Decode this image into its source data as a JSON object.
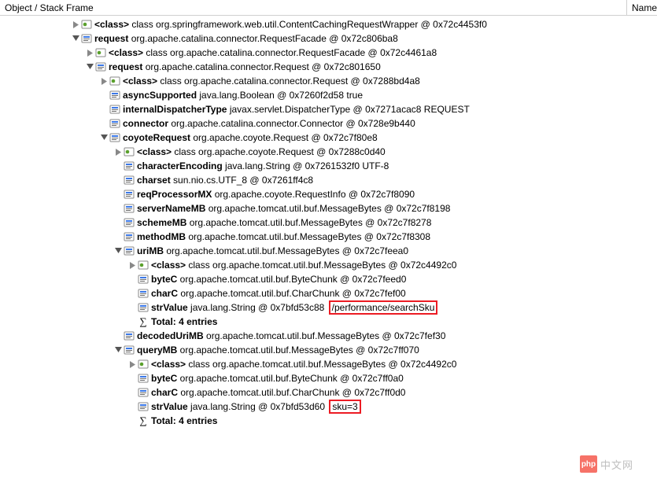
{
  "header": {
    "col1": "Object / Stack Frame",
    "col2": "Name"
  },
  "rows": [
    {
      "depth": 5,
      "tw": "r",
      "ic": "cls",
      "name": "<class>",
      "rest": " class org.springframework.web.util.ContentCachingRequestWrapper @ 0x72c4453f0"
    },
    {
      "depth": 5,
      "tw": "d",
      "ic": "obj",
      "name": "request",
      "rest": " org.apache.catalina.connector.RequestFacade @ 0x72c806ba8"
    },
    {
      "depth": 6,
      "tw": "r",
      "ic": "cls",
      "name": "<class>",
      "rest": " class org.apache.catalina.connector.RequestFacade @ 0x72c4461a8"
    },
    {
      "depth": 6,
      "tw": "d",
      "ic": "obj",
      "name": "request",
      "rest": " org.apache.catalina.connector.Request @ 0x72c801650"
    },
    {
      "depth": 7,
      "tw": "r",
      "ic": "cls",
      "name": "<class>",
      "rest": " class org.apache.catalina.connector.Request @ 0x7288bd4a8"
    },
    {
      "depth": 7,
      "tw": "n",
      "ic": "obj",
      "name": "asyncSupported",
      "rest": " java.lang.Boolean @ 0x7260f2d58  true"
    },
    {
      "depth": 7,
      "tw": "n",
      "ic": "obj",
      "name": "internalDispatcherType",
      "rest": " javax.servlet.DispatcherType @ 0x7271acac8  REQUEST"
    },
    {
      "depth": 7,
      "tw": "n",
      "ic": "obj",
      "name": "connector",
      "rest": " org.apache.catalina.connector.Connector @ 0x728e9b440"
    },
    {
      "depth": 7,
      "tw": "d",
      "ic": "obj",
      "name": "coyoteRequest",
      "rest": " org.apache.coyote.Request @ 0x72c7f80e8"
    },
    {
      "depth": 8,
      "tw": "r",
      "ic": "cls",
      "name": "<class>",
      "rest": " class org.apache.coyote.Request @ 0x7288c0d40"
    },
    {
      "depth": 8,
      "tw": "n",
      "ic": "obj",
      "name": "characterEncoding",
      "rest": " java.lang.String @ 0x7261532f0  UTF-8"
    },
    {
      "depth": 8,
      "tw": "n",
      "ic": "obj",
      "name": "charset",
      "rest": " sun.nio.cs.UTF_8 @ 0x7261ff4c8"
    },
    {
      "depth": 8,
      "tw": "n",
      "ic": "obj",
      "name": "reqProcessorMX",
      "rest": " org.apache.coyote.RequestInfo @ 0x72c7f8090"
    },
    {
      "depth": 8,
      "tw": "n",
      "ic": "obj",
      "name": "serverNameMB",
      "rest": " org.apache.tomcat.util.buf.MessageBytes @ 0x72c7f8198"
    },
    {
      "depth": 8,
      "tw": "n",
      "ic": "obj",
      "name": "schemeMB",
      "rest": " org.apache.tomcat.util.buf.MessageBytes @ 0x72c7f8278"
    },
    {
      "depth": 8,
      "tw": "n",
      "ic": "obj",
      "name": "methodMB",
      "rest": " org.apache.tomcat.util.buf.MessageBytes @ 0x72c7f8308"
    },
    {
      "depth": 8,
      "tw": "d",
      "ic": "obj",
      "name": "uriMB",
      "rest": " org.apache.tomcat.util.buf.MessageBytes @ 0x72c7feea0"
    },
    {
      "depth": 9,
      "tw": "r",
      "ic": "cls",
      "name": "<class>",
      "rest": " class org.apache.tomcat.util.buf.MessageBytes @ 0x72c4492c0"
    },
    {
      "depth": 9,
      "tw": "n",
      "ic": "obj",
      "name": "byteC",
      "rest": " org.apache.tomcat.util.buf.ByteChunk @ 0x72c7feed0"
    },
    {
      "depth": 9,
      "tw": "n",
      "ic": "obj",
      "name": "charC",
      "rest": " org.apache.tomcat.util.buf.CharChunk @ 0x72c7fef00"
    },
    {
      "depth": 9,
      "tw": "n",
      "ic": "obj",
      "name": "strValue",
      "rest": " java.lang.String @ 0x7bfd53c88 ",
      "box": "/performance/searchSku"
    },
    {
      "depth": 9,
      "tw": "n",
      "ic": "sum",
      "name": "",
      "rest": "Total: 4 entries",
      "boldrest": true
    },
    {
      "depth": 8,
      "tw": "n",
      "ic": "obj",
      "name": "decodedUriMB",
      "rest": " org.apache.tomcat.util.buf.MessageBytes @ 0x72c7fef30"
    },
    {
      "depth": 8,
      "tw": "d",
      "ic": "obj",
      "name": "queryMB",
      "rest": " org.apache.tomcat.util.buf.MessageBytes @ 0x72c7ff070"
    },
    {
      "depth": 9,
      "tw": "r",
      "ic": "cls",
      "name": "<class>",
      "rest": " class org.apache.tomcat.util.buf.MessageBytes @ 0x72c4492c0"
    },
    {
      "depth": 9,
      "tw": "n",
      "ic": "obj",
      "name": "byteC",
      "rest": " org.apache.tomcat.util.buf.ByteChunk @ 0x72c7ff0a0"
    },
    {
      "depth": 9,
      "tw": "n",
      "ic": "obj",
      "name": "charC",
      "rest": " org.apache.tomcat.util.buf.CharChunk @ 0x72c7ff0d0"
    },
    {
      "depth": 9,
      "tw": "n",
      "ic": "obj",
      "name": "strValue",
      "rest": " java.lang.String @ 0x7bfd53d60 ",
      "box": "sku=3"
    },
    {
      "depth": 9,
      "tw": "n",
      "ic": "sum",
      "name": "",
      "rest": "Total: 4 entries",
      "boldrest": true
    }
  ],
  "watermark": {
    "logo": "php",
    "text": "中文网"
  }
}
